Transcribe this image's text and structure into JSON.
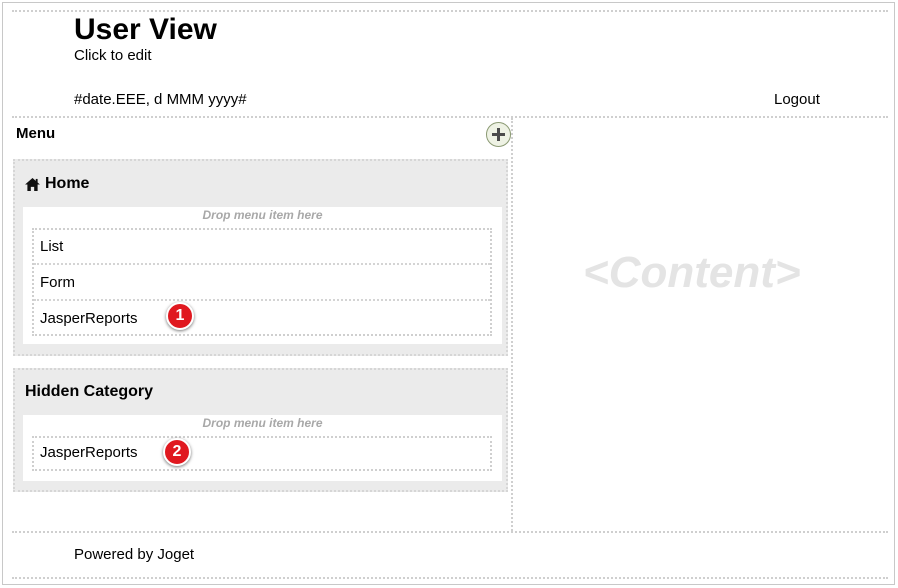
{
  "header": {
    "title": "User View",
    "subtitle": "Click to edit",
    "date_format": "#date.EEE, d MMM yyyy#",
    "logout_label": "Logout"
  },
  "menu": {
    "label": "Menu",
    "add_icon": "plus-icon",
    "categories": [
      {
        "label": "Home",
        "icon": "home-icon",
        "drop_hint": "Drop menu item here",
        "items": [
          {
            "label": "List"
          },
          {
            "label": "Form"
          },
          {
            "label": "JasperReports",
            "badge": "1"
          }
        ]
      },
      {
        "label": "Hidden Category",
        "drop_hint": "Drop menu item here",
        "items": [
          {
            "label": "JasperReports",
            "badge": "2"
          }
        ]
      }
    ]
  },
  "content": {
    "placeholder": "<Content>"
  },
  "footer": {
    "text": "Powered by Joget"
  },
  "colors": {
    "badge": "#e0181f",
    "border_dotted": "#cfcfcf",
    "category_bg": "#ebebeb",
    "add_button": "#eef2e4"
  }
}
